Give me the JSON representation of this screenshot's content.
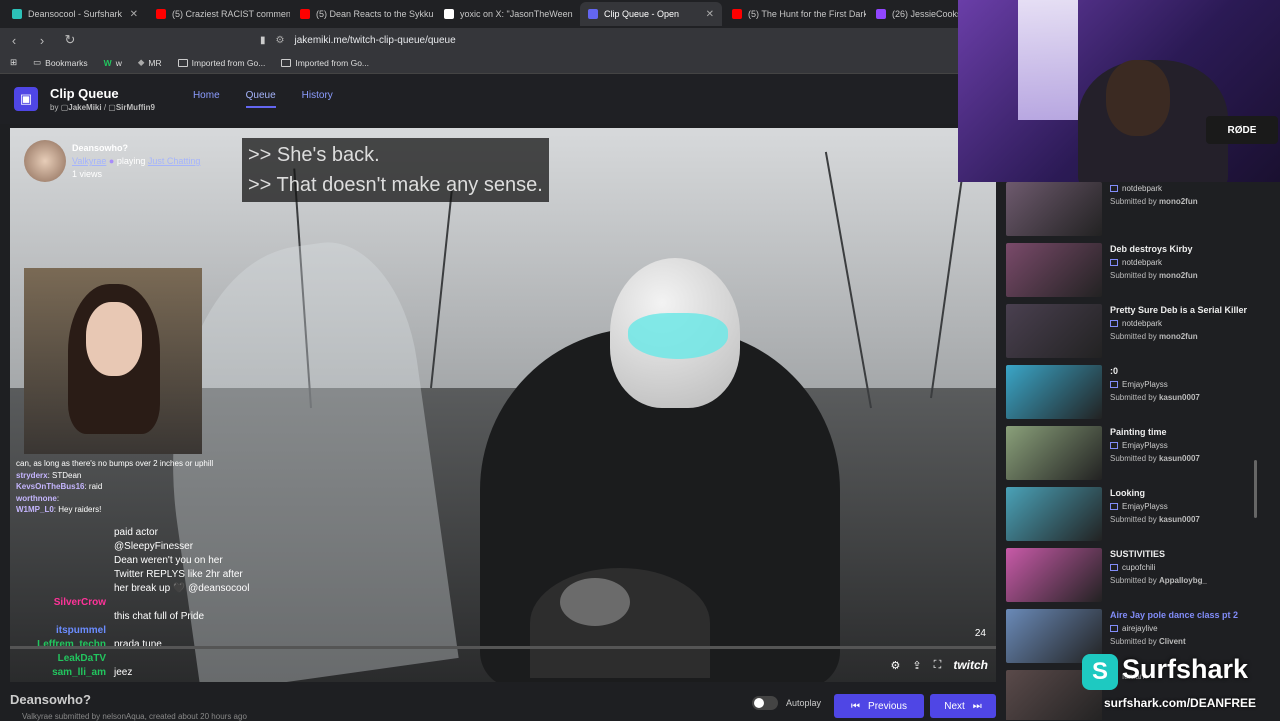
{
  "tabs": [
    {
      "label": "Deansocool - Surfshark",
      "color": "#2cc1b8"
    },
    {
      "label": "(5) Craziest RACIST comments",
      "color": "#ff0000"
    },
    {
      "label": "(5) Dean Reacts to the Sykkuno",
      "color": "#ff0000"
    },
    {
      "label": "yoxic on X: \"JasonTheWeen",
      "color": "#ffffff"
    },
    {
      "label": "Clip Queue - Open",
      "color": "#6366f1",
      "active": true
    },
    {
      "label": "(5) The Hunt for the First Dark",
      "color": "#ff0000"
    },
    {
      "label": "(26) JessieCooks - Twi",
      "color": "#9146ff"
    }
  ],
  "url": "jakemiki.me/twitch-clip-queue/queue",
  "bookmarks": [
    "Bookmarks",
    "w",
    "MR",
    "Imported from Go...",
    "Imported from Go..."
  ],
  "app": {
    "title": "Clip Queue",
    "by": "by",
    "user1": "JakeMiki",
    "user2": "SirMuffin9",
    "nav": [
      "Home",
      "Queue",
      "History"
    ]
  },
  "clip": {
    "channel": "Deansowho?",
    "streamer": "Valkyrae",
    "playing": "playing",
    "game": "Just Chatting",
    "views": "1 views",
    "caption1": ">> She's back.",
    "caption2": ">> That doesn't make any sense.",
    "counter": "24",
    "twitch": "twitch"
  },
  "chat_small": [
    {
      "text": "can, as long as there's no bumps over 2 inches or uphill"
    },
    {
      "user": "stryderx",
      "text": "STDean"
    },
    {
      "user": "KevsOnTheBus16",
      "text": "raid"
    },
    {
      "user": "worthnone",
      "text": ""
    },
    {
      "user": "W1MP_L0",
      "text": "Hey raiders!"
    }
  ],
  "chat_big": [
    {
      "user": "",
      "text": "paid actor",
      "color": "#e25555"
    },
    {
      "user": "",
      "text": "",
      "color": "#8b5cf6"
    },
    {
      "user": "",
      "text": "@SleepyFinesser",
      "color": "#6b8cff"
    },
    {
      "user": "",
      "text": "Dean weren't you on her",
      "color": "#e8503a"
    },
    {
      "user": "",
      "text": "Twitter REPLYS like 2hr after",
      "color": "#e8503a"
    },
    {
      "user": "",
      "text": "her break up 🖤 @deansocool",
      "color": "#e8503a"
    },
    {
      "user": "SilverCrow",
      "text": "",
      "color": "#ff3399"
    },
    {
      "user": "",
      "text": "this chat full of Pride",
      "color": "#e8503a"
    },
    {
      "user": "itspummel",
      "text": "",
      "color": "#6b8cff"
    },
    {
      "user": "Leffrem_techn",
      "text": "prada tune",
      "color": "#22c55e"
    },
    {
      "user": "LeakDaTV",
      "text": "",
      "color": "#22c55e"
    },
    {
      "user": "sam_lli_am",
      "text": "jeez",
      "color": "#22c55e"
    }
  ],
  "bottom": {
    "channel_name": "Deansowho?",
    "submitted": "Valkyrae submitted by nelsonAqua, created about 20 hours ago",
    "autoplay": "Autoplay",
    "previous": "Previous",
    "next": "Next"
  },
  "queue": [
    {
      "title": "",
      "channel": "notdebpark",
      "submitter": "mono2fun",
      "submitted_by": "Submitted by",
      "color": "#6e5a6e"
    },
    {
      "title": "Deb destroys Kirby",
      "channel": "notdebpark",
      "submitter": "mono2fun",
      "submitted_by": "Submitted by",
      "color": "#7a4a6a"
    },
    {
      "title": "Pretty Sure Deb is a Serial Killer",
      "channel": "notdebpark",
      "submitter": "mono2fun",
      "submitted_by": "Submitted by",
      "color": "#4a4050"
    },
    {
      "title": ":0",
      "channel": "EmjayPlayss",
      "submitter": "kasun0007",
      "submitted_by": "Submitted by",
      "color": "#3aa6c8"
    },
    {
      "title": "Painting time",
      "channel": "EmjayPlayss",
      "submitter": "kasun0007",
      "submitted_by": "Submitted by",
      "color": "#8aa07a"
    },
    {
      "title": "Looking",
      "channel": "EmjayPlayss",
      "submitter": "kasun0007",
      "submitted_by": "Submitted by",
      "color": "#4aa2b8"
    },
    {
      "title": "SUSTIVITIES",
      "channel": "cupofchili",
      "submitter": "Appalloybg_",
      "submitted_by": "Submitted by",
      "color": "#c85aa8"
    },
    {
      "title": "Aire Jay pole dance class pt 2",
      "channel": "airejaylive",
      "submitter": "Clivent",
      "submitted_by": "Submitted by",
      "color": "#6a8ab8",
      "highlight": true
    },
    {
      "title": "",
      "channel": "fanfan",
      "submitter": "",
      "submitted_by": "",
      "color": "#5a4a4a"
    }
  ],
  "webcam": {
    "mic_label": "RØDE"
  },
  "sponsor": {
    "logo": "S",
    "name": "Surfshark",
    "url": "surfshark.com/DEANFREE"
  }
}
